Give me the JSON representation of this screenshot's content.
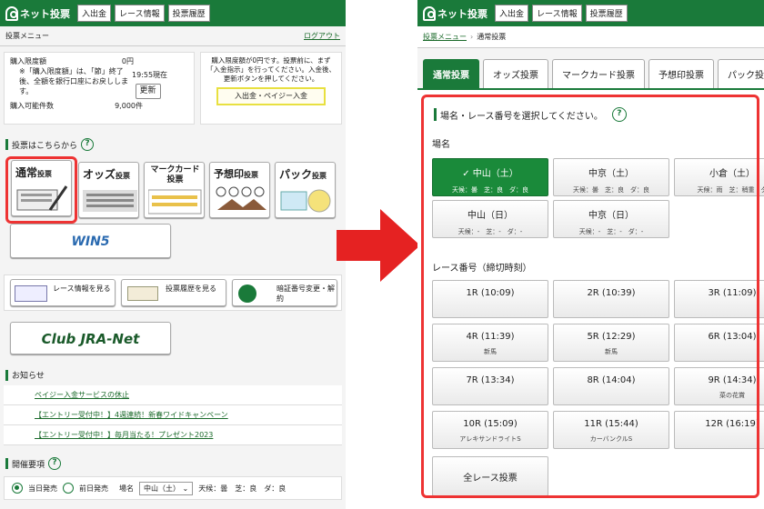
{
  "header": {
    "logo_label": "ネット投票",
    "buttons": [
      "入出金",
      "レース情報",
      "投票履歴"
    ]
  },
  "left": {
    "menu_label": "投票メニュー",
    "logout": "ログアウト",
    "limit_label": "購入限度額",
    "limit_value": "0円",
    "limit_note": "※「購入限度額」は、「節」終了後、全額を銀行口座にお戻しします。",
    "time_label": "19:55現在",
    "refresh": "更新",
    "count_label": "購入可能件数",
    "count_value": "9,000件",
    "info_text": "購入限度額が0円です。投票前に、まず「入金指示」を行ってください。入金後、更新ボタンを押してください。",
    "deposit_button": "入出金・ペイジー入金",
    "vote_here": "投票はこちらから",
    "vote_buttons": [
      {
        "title": "通常",
        "suffix": "投票"
      },
      {
        "title": "オッズ",
        "suffix": "投票"
      },
      {
        "title": "マークカード",
        "suffix": "投票"
      },
      {
        "title": "予想印",
        "suffix": "投票"
      },
      {
        "title": "パック",
        "suffix": "投票"
      }
    ],
    "win5": "WIN5",
    "links": [
      {
        "label": "レース情報を見る"
      },
      {
        "label": "投票履歴を見る"
      },
      {
        "label": "暗証番号変更・解約"
      }
    ],
    "club": "Club JRA-Net",
    "notice_title": "お知らせ",
    "notices": [
      "ペイジー入金サービスの休止",
      "【エントリー受付中！】4週連続！新春ワイドキャンペーン",
      "【エントリー受付中！】毎月当たる！プレゼント2023"
    ],
    "schedule_title": "開催要項",
    "radio_today": "当日発売",
    "radio_prev": "前日発売",
    "venue_label": "場名",
    "venue_value": "中山（土）",
    "weather": "天候：曇　芝：良　ダ：良"
  },
  "right": {
    "breadcrumb": [
      "投票メニュー",
      "通常投票"
    ],
    "tabs": [
      "通常投票",
      "オッズ投票",
      "マークカード投票",
      "予想印投票",
      "パック投票"
    ],
    "instruction": "場名・レース番号を選択してください。",
    "venue_section": "場名",
    "venues": [
      {
        "name": "✓ 中山（土）",
        "cond": "天候：曇　芝：良　ダ：良"
      },
      {
        "name": "中京（土）",
        "cond": "天候：曇　芝：良　ダ：良"
      },
      {
        "name": "小倉（土）",
        "cond": "天候：雨　芝：稍重　ダ"
      },
      {
        "name": "中山（日）",
        "cond": "天候：-　芝：-　ダ：-"
      },
      {
        "name": "中京（日）",
        "cond": "天候：-　芝：-　ダ：-"
      }
    ],
    "race_section": "レース番号（締切時刻）",
    "races": [
      {
        "name": "1R (10:09)",
        "sub": ""
      },
      {
        "name": "2R (10:39)",
        "sub": ""
      },
      {
        "name": "3R (11:09)",
        "sub": ""
      },
      {
        "name": "4R (11:39)",
        "sub": "新馬"
      },
      {
        "name": "5R (12:29)",
        "sub": "新馬"
      },
      {
        "name": "6R (13:04)",
        "sub": ""
      },
      {
        "name": "7R (13:34)",
        "sub": ""
      },
      {
        "name": "8R (14:04)",
        "sub": ""
      },
      {
        "name": "9R (14:34)",
        "sub": "菜の花賞"
      },
      {
        "name": "10R (15:09)",
        "sub": "アレキサンドライトS"
      },
      {
        "name": "11R (15:44)",
        "sub": "カーバンクルS"
      },
      {
        "name": "12R (16:19)",
        "sub": ""
      }
    ],
    "all_races": "全レース投票"
  },
  "colors": {
    "brand": "#1a7a3a",
    "highlight": "#e33333",
    "arrow": "#e52222"
  }
}
